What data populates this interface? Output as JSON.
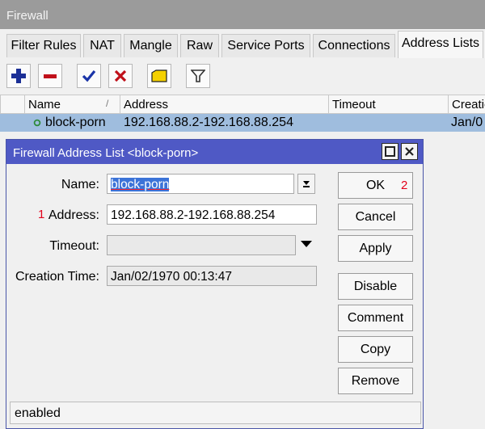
{
  "window": {
    "title": "Firewall"
  },
  "tabs": [
    {
      "label": "Filter Rules"
    },
    {
      "label": "NAT"
    },
    {
      "label": "Mangle"
    },
    {
      "label": "Raw"
    },
    {
      "label": "Service Ports"
    },
    {
      "label": "Connections"
    },
    {
      "label": "Address Lists",
      "active": true
    }
  ],
  "toolbar": {
    "buttons": [
      {
        "icon": "plus-icon",
        "color": "#1b2f96"
      },
      {
        "icon": "minus-icon",
        "color": "#c0101a"
      },
      {
        "icon": "check-icon",
        "color": "#1a34a8"
      },
      {
        "icon": "cross-icon",
        "color": "#c0101a"
      },
      {
        "icon": "comment-icon",
        "color": "#e8c400"
      },
      {
        "icon": "filter-icon",
        "color": "#333333"
      }
    ]
  },
  "table": {
    "columns": [
      "Name",
      "Address",
      "Timeout",
      "Creatio"
    ],
    "sort_indicator": "/",
    "rows": [
      {
        "name": "block-porn",
        "address": "192.168.88.2-192.168.88.254",
        "timeout": "",
        "creation": "Jan/0"
      }
    ]
  },
  "dialog": {
    "title": "Firewall Address List <block-porn>",
    "fields": {
      "name_label": "Name:",
      "name_value": "block-porn",
      "address_label": "Address:",
      "address_value": "192.168.88.2-192.168.88.254",
      "timeout_label": "Timeout:",
      "timeout_value": "",
      "creation_label": "Creation Time:",
      "creation_value": "Jan/02/1970 00:13:47"
    },
    "buttons": {
      "ok": "OK",
      "cancel": "Cancel",
      "apply": "Apply",
      "disable": "Disable",
      "comment": "Comment",
      "copy": "Copy",
      "remove": "Remove"
    },
    "status": "enabled",
    "markers": {
      "address": "1",
      "ok": "2"
    }
  },
  "colors": {
    "selection": "#9fbdde",
    "dialog_title_bar": "#4f59c5",
    "marker": "#e2001a",
    "status_dot": "#2e8b3a"
  }
}
